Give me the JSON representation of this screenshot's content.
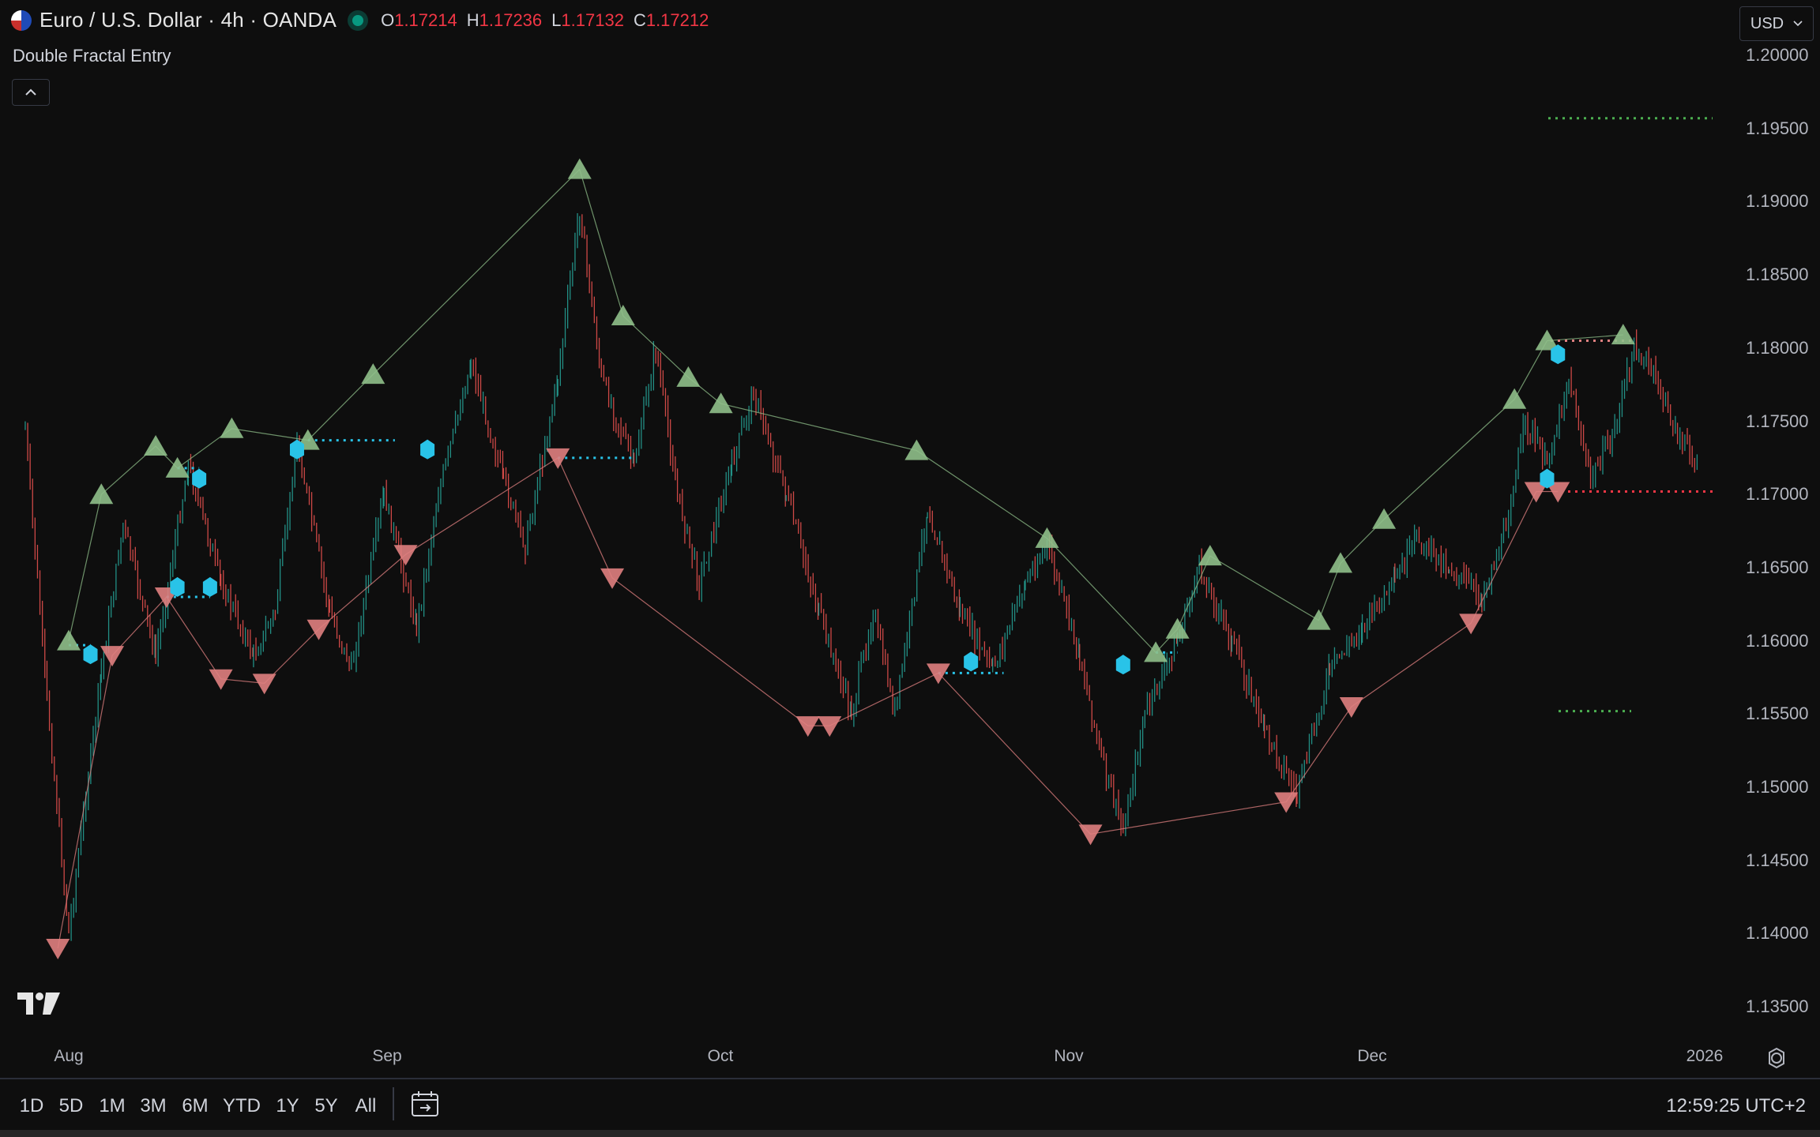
{
  "header": {
    "symbol_title": "Euro / U.S. Dollar · 4h · OANDA",
    "ohlc": [
      {
        "k": "O",
        "v": "1.17214"
      },
      {
        "k": "H",
        "v": "1.17236"
      },
      {
        "k": "L",
        "v": "1.17132"
      },
      {
        "k": "C",
        "v": "1.17212"
      }
    ],
    "status_color": "#089981",
    "flag_icon": "eur-usd-flag-icon"
  },
  "indicator": {
    "name": "Double Fractal Entry",
    "collapse_icon": "chevron-up-icon"
  },
  "currency": {
    "label": "USD",
    "icon": "chevron-down-icon"
  },
  "price_axis": [
    "1.20000",
    "1.19500",
    "1.19000",
    "1.18500",
    "1.18000",
    "1.17500",
    "1.17000",
    "1.16500",
    "1.16000",
    "1.15500",
    "1.15000",
    "1.14500",
    "1.14000",
    "1.13500"
  ],
  "time_axis": [
    "Aug",
    "Sep",
    "Oct",
    "Nov",
    "Dec",
    "2026"
  ],
  "bottom_bar": {
    "ranges": [
      "1D",
      "5D",
      "1M",
      "3M",
      "6M",
      "YTD",
      "1Y",
      "5Y",
      "All"
    ],
    "date_range_icon": "calendar-goto-icon",
    "clock": "12:59:25 UTC+2"
  },
  "colors": {
    "background": "#0e0e0e",
    "up_candle": "#26a69a",
    "down_candle": "#ef5350",
    "fractal_up": "#8fbf8a",
    "fractal_down": "#e08080",
    "entry_marker": "#29c3e8",
    "ohlc_value": "#f23645"
  },
  "chart_data": {
    "type": "candlestick",
    "symbol": "EURUSD",
    "timeframe": "4h",
    "ylim": [
      1.133,
      1.202
    ],
    "x_ticks": [
      "Aug",
      "Sep",
      "Oct",
      "Nov",
      "Dec",
      "2026"
    ],
    "price_path": [
      [
        "Jul 28",
        1.1745
      ],
      [
        "Jul 30",
        1.156
      ],
      [
        "Aug 1",
        1.14
      ],
      [
        "Aug 4",
        1.158
      ],
      [
        "Aug 6",
        1.168
      ],
      [
        "Aug 9",
        1.159
      ],
      [
        "Aug 12",
        1.172
      ],
      [
        "Aug 15",
        1.164
      ],
      [
        "Aug 18",
        1.159
      ],
      [
        "Aug 20",
        1.162
      ],
      [
        "Aug 22",
        1.1735
      ],
      [
        "Aug 25",
        1.162
      ],
      [
        "Aug 27",
        1.158
      ],
      [
        "Aug 30",
        1.17
      ],
      [
        "Sep 2",
        1.161
      ],
      [
        "Sep 4",
        1.17
      ],
      [
        "Sep 7",
        1.179
      ],
      [
        "Sep 10",
        1.171
      ],
      [
        "Sep 12",
        1.1665
      ],
      [
        "Sep 15",
        1.178
      ],
      [
        "Sep 17",
        1.1895
      ],
      [
        "Sep 19",
        1.178
      ],
      [
        "Sep 22",
        1.172
      ],
      [
        "Sep 24",
        1.18
      ],
      [
        "Sep 26",
        1.17
      ],
      [
        "Sep 28",
        1.164
      ],
      [
        "Oct 1",
        1.172
      ],
      [
        "Oct 3",
        1.177
      ],
      [
        "Oct 6",
        1.17
      ],
      [
        "Oct 9",
        1.162
      ],
      [
        "Oct 12",
        1.155
      ],
      [
        "Oct 14",
        1.162
      ],
      [
        "Oct 16",
        1.155
      ],
      [
        "Oct 19",
        1.169
      ],
      [
        "Oct 22",
        1.162
      ],
      [
        "Oct 25",
        1.158
      ],
      [
        "Oct 28",
        1.164
      ],
      [
        "Oct 30",
        1.1665
      ],
      [
        "Nov 2",
        1.159
      ],
      [
        "Nov 4",
        1.152
      ],
      [
        "Nov 6",
        1.147
      ],
      [
        "Nov 8",
        1.155
      ],
      [
        "Nov 11",
        1.16
      ],
      [
        "Nov 13",
        1.165
      ],
      [
        "Nov 16",
        1.16
      ],
      [
        "Nov 19",
        1.154
      ],
      [
        "Nov 22",
        1.1495
      ],
      [
        "Nov 25",
        1.158
      ],
      [
        "Nov 28",
        1.161
      ],
      [
        "Dec 1",
        1.164
      ],
      [
        "Dec 3",
        1.167
      ],
      [
        "Dec 6",
        1.165
      ],
      [
        "Dec 9",
        1.163
      ],
      [
        "Dec 11",
        1.167
      ],
      [
        "Dec 13",
        1.175
      ],
      [
        "Dec 15",
        1.172
      ],
      [
        "Dec 17",
        1.178
      ],
      [
        "Dec 19",
        1.171
      ],
      [
        "Dec 21",
        1.174
      ],
      [
        "Dec 23",
        1.18
      ],
      [
        "Dec 25",
        1.178
      ],
      [
        "Dec 27",
        1.174
      ],
      [
        "Dec 29",
        1.172
      ]
    ],
    "series": [
      {
        "role": "fractal_highs",
        "points": [
          [
            "Aug 1",
            1.16
          ],
          [
            "Aug 4",
            1.17
          ],
          [
            "Aug 9",
            1.1733
          ],
          [
            "Aug 11",
            1.1718
          ],
          [
            "Aug 16",
            1.1745
          ],
          [
            "Aug 23",
            1.1737
          ],
          [
            "Aug 29",
            1.1782
          ],
          [
            "Sep 17",
            1.1922
          ],
          [
            "Sep 21",
            1.1822
          ],
          [
            "Sep 27",
            1.178
          ],
          [
            "Sep 30",
            1.1762
          ],
          [
            "Oct 18",
            1.173
          ],
          [
            "Oct 30",
            1.167
          ],
          [
            "Nov 9",
            1.1592
          ],
          [
            "Nov 11",
            1.1608
          ],
          [
            "Nov 14",
            1.1658
          ],
          [
            "Nov 24",
            1.1614
          ],
          [
            "Nov 26",
            1.1653
          ],
          [
            "Nov 30",
            1.1683
          ],
          [
            "Dec 12",
            1.1765
          ],
          [
            "Dec 15",
            1.1805
          ],
          [
            "Dec 22",
            1.1809
          ]
        ]
      },
      {
        "role": "fractal_lows",
        "points": [
          [
            "Jul 31",
            1.139
          ],
          [
            "Aug 5",
            1.159
          ],
          [
            "Aug 10",
            1.163
          ],
          [
            "Aug 15",
            1.1574
          ],
          [
            "Aug 19",
            1.1571
          ],
          [
            "Aug 24",
            1.1608
          ],
          [
            "Sep 1",
            1.1659
          ],
          [
            "Sep 15",
            1.1725
          ],
          [
            "Sep 20",
            1.1643
          ],
          [
            "Oct 8",
            1.1542
          ],
          [
            "Oct 10",
            1.1542
          ],
          [
            "Oct 20",
            1.1578
          ],
          [
            "Nov 3",
            1.1468
          ],
          [
            "Nov 21",
            1.149
          ],
          [
            "Nov 27",
            1.1555
          ],
          [
            "Dec 8",
            1.1612
          ],
          [
            "Dec 14",
            1.1702
          ],
          [
            "Dec 16",
            1.1702
          ]
        ]
      },
      {
        "role": "entry_markers",
        "points": [
          [
            "Aug 3",
            1.159
          ],
          [
            "Aug 13",
            1.171
          ],
          [
            "Aug 11",
            1.1636
          ],
          [
            "Aug 14",
            1.1636
          ],
          [
            "Aug 22",
            1.173
          ],
          [
            "Sep 3",
            1.173
          ],
          [
            "Oct 23",
            1.1585
          ],
          [
            "Nov 6",
            1.1583
          ],
          [
            "Dec 15",
            1.171
          ],
          [
            "Dec 16",
            1.1795
          ]
        ]
      },
      {
        "role": "levels",
        "points": [
          [
            "green-upper",
            1.1957
          ],
          [
            "green-lower",
            1.1552
          ],
          [
            "red",
            1.1702
          ],
          [
            "pink",
            1.1805
          ]
        ]
      }
    ]
  }
}
